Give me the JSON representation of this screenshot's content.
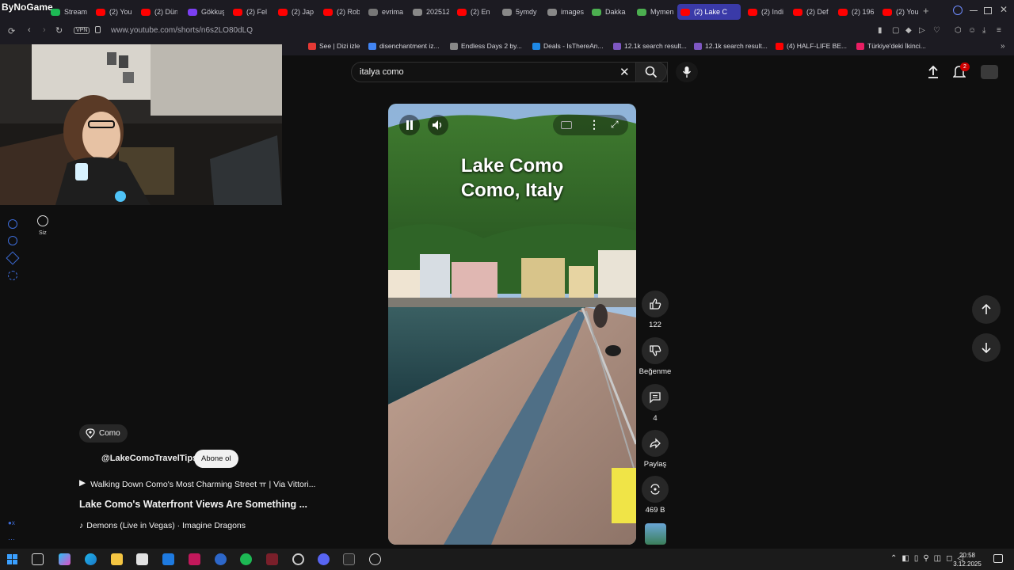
{
  "browser": {
    "overlay_label": "ByNoGame",
    "tabs": [
      {
        "label": "Stream",
        "color": "#1db954"
      },
      {
        "label": "(2) You",
        "color": "#ff0000"
      },
      {
        "label": "(2) Dün",
        "color": "#ff0000"
      },
      {
        "label": "Gökkuş",
        "color": "#7b3ff2"
      },
      {
        "label": "(2) Fel",
        "color": "#ff0000"
      },
      {
        "label": "(2) Jap",
        "color": "#ff0000"
      },
      {
        "label": "(2) Rob",
        "color": "#ff0000"
      },
      {
        "label": "evrima",
        "color": "#777777"
      },
      {
        "label": "202512",
        "color": "#888888"
      },
      {
        "label": "(2) En",
        "color": "#ff0000"
      },
      {
        "label": "5ymdy",
        "color": "#888888"
      },
      {
        "label": "images",
        "color": "#888888"
      },
      {
        "label": "Dakka",
        "color": "#4caf50"
      },
      {
        "label": "Mymen",
        "color": "#4caf50"
      },
      {
        "label": "(2) Lake C",
        "color": "#ff0000",
        "active": true
      },
      {
        "label": "(2) Indi",
        "color": "#ff0000"
      },
      {
        "label": "(2) Def",
        "color": "#ff0000"
      },
      {
        "label": "(2) 196",
        "color": "#ff0000"
      },
      {
        "label": "(2) You",
        "color": "#ff0000"
      }
    ],
    "vpn_label": "VPN",
    "url": "www.youtube.com/shorts/n6s2LO80dLQ",
    "bookmarks": [
      {
        "label": "See | Dizi izle",
        "color": "#e53935"
      },
      {
        "label": "disenchantment iz...",
        "color": "#4285f4"
      },
      {
        "label": "Endless Days 2 by...",
        "color": "#888888"
      },
      {
        "label": "Deals - IsThereAn...",
        "color": "#1e88e5"
      },
      {
        "label": "12.1k search result...",
        "color": "#7e57c2"
      },
      {
        "label": "12.1k search result...",
        "color": "#7e57c2"
      },
      {
        "label": "(4) HALF-LIFE BE...",
        "color": "#ff0000"
      },
      {
        "label": "Türkiye'deki İkinci...",
        "color": "#e91e63"
      }
    ]
  },
  "youtube": {
    "search_value": "italya como",
    "notification_count": "2",
    "left_rail_label": "Siz",
    "video": {
      "overlay_title_line1": "Lake Como",
      "overlay_title_line2": "Como, Italy"
    },
    "location": "Como",
    "channel": "@LakeComoTravelTips",
    "subscribe_label": "Abone ol",
    "playlist_line": "Walking Down Como's Most Charming Street ㅠ | Via Vittori...",
    "title": "Lake Como's Waterfront Views Are Something ...",
    "music": "Demons (Live in Vegas) · Imagine Dragons",
    "actions": {
      "like_count": "122",
      "dislike_label": "Beğenme",
      "comment_count": "4",
      "share_label": "Paylaş",
      "remix_count": "469 B"
    }
  },
  "taskbar": {
    "time": "20:58",
    "date": "3.12.2025"
  }
}
